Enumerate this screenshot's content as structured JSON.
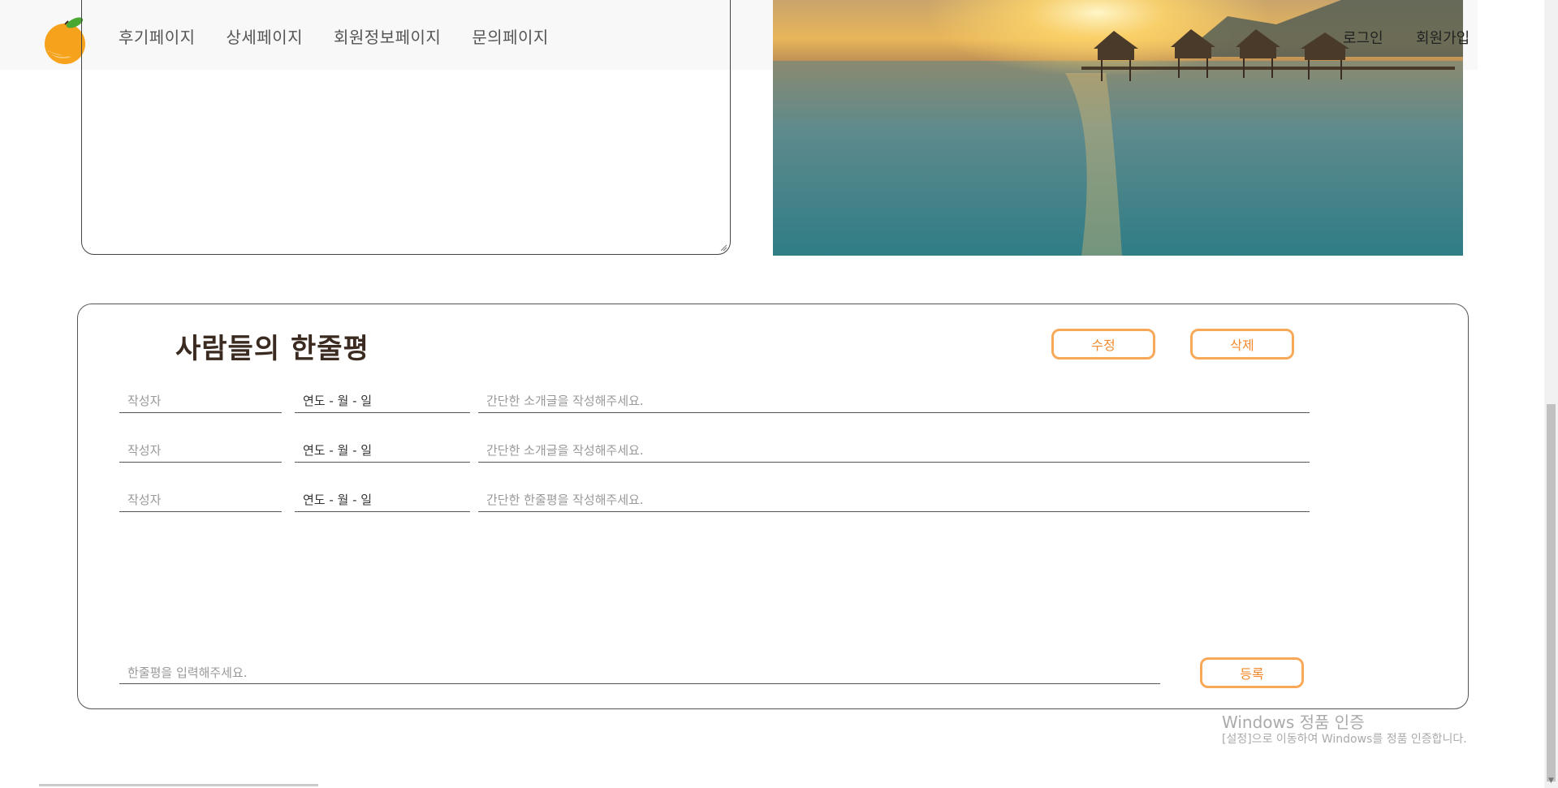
{
  "header": {
    "nav": [
      "후기페이지",
      "상세페이지",
      "회원정보페이지",
      "문의페이지"
    ],
    "login": "로그인",
    "signup": "회원가입"
  },
  "review": {
    "title": "사람들의 한줄평",
    "edit_label": "수정",
    "delete_label": "삭제",
    "rows": [
      {
        "author": "작성자",
        "date": "연도 - 월 - 일",
        "text": "간단한 소개글을 작성해주세요."
      },
      {
        "author": "작성자",
        "date": "연도 - 월 - 일",
        "text": "간단한 소개글을 작성해주세요."
      },
      {
        "author": "작성자",
        "date": "연도 - 월 - 일",
        "text": "간단한 한줄평을 작성해주세요."
      }
    ],
    "input_placeholder": "한줄평을 입력해주세요.",
    "register_label": "등록"
  },
  "watermark": {
    "title": "Windows 정품 인증",
    "subtitle": "[설정]으로 이동하여 Windows를 정품 인증합니다."
  },
  "colors": {
    "accent": "#f7a959",
    "accent_text": "#f08a2c",
    "title": "#3a2a20",
    "header_bg": "#f8f8f8"
  }
}
